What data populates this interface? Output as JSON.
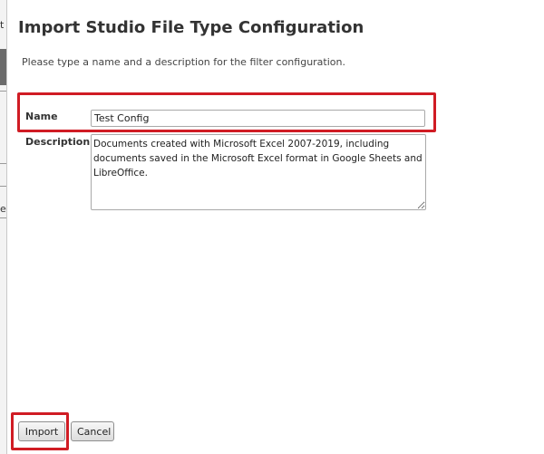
{
  "dialog": {
    "title": "Import Studio File Type Configuration",
    "instructions": "Please type a name and a description for the filter configuration."
  },
  "form": {
    "name_label": "Name",
    "name_value": "Test Config",
    "description_label": "Description",
    "description_value": "Documents created with Microsoft Excel 2007-2019, including documents saved in the Microsoft Excel format in Google Sheets and LibreOffice."
  },
  "buttons": {
    "import_label": "Import",
    "cancel_label": "Cancel"
  },
  "background": {
    "glyph_1": "t",
    "glyph_2": "e"
  },
  "colors": {
    "highlight": "#d01c24"
  }
}
